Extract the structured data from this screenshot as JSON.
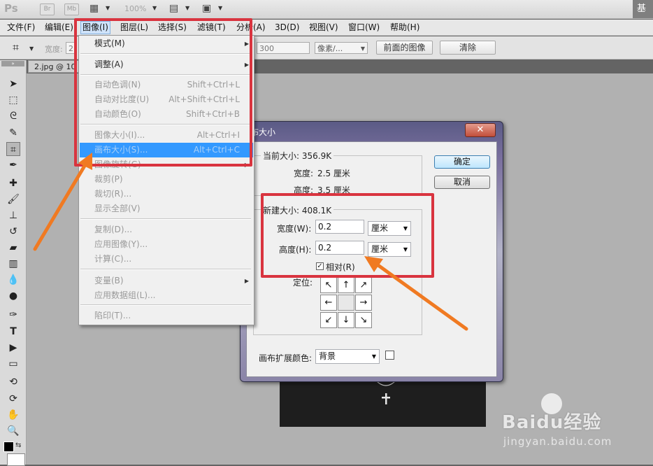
{
  "titlebar": {
    "app_logo": "Ps",
    "bridge_label": "Br",
    "minibridge_label": "Mb",
    "zoom": "100%",
    "workspace_label": "基"
  },
  "menubar": {
    "items": [
      "文件(F)",
      "编辑(E)",
      "图像(I)",
      "图层(L)",
      "选择(S)",
      "滤镜(T)",
      "分析(A)",
      "3D(D)",
      "视图(V)",
      "窗口(W)",
      "帮助(H)"
    ]
  },
  "options_bar": {
    "width_label": "宽度:",
    "width_value": "2",
    "resolution_value": "300",
    "unit_value": "像素/...",
    "front_image_button": "前面的图像",
    "clear_button": "清除"
  },
  "document": {
    "tab_label": "2.jpg @ 10"
  },
  "image_menu": {
    "items": [
      {
        "label": "模式(M)",
        "shortcut": "",
        "submenu": true,
        "disabled": false,
        "highlighted": false
      },
      {
        "label": "调整(A)",
        "shortcut": "",
        "submenu": true,
        "disabled": false,
        "highlighted": false
      },
      {
        "label": "自动色调(N)",
        "shortcut": "Shift+Ctrl+L",
        "submenu": false,
        "disabled": true,
        "highlighted": false
      },
      {
        "label": "自动对比度(U)",
        "shortcut": "Alt+Shift+Ctrl+L",
        "submenu": false,
        "disabled": true,
        "highlighted": false
      },
      {
        "label": "自动颜色(O)",
        "shortcut": "Shift+Ctrl+B",
        "submenu": false,
        "disabled": true,
        "highlighted": false
      },
      {
        "label": "图像大小(I)...",
        "shortcut": "Alt+Ctrl+I",
        "submenu": false,
        "disabled": true,
        "highlighted": false
      },
      {
        "label": "画布大小(S)...",
        "shortcut": "Alt+Ctrl+C",
        "submenu": false,
        "disabled": false,
        "highlighted": true
      },
      {
        "label": "图像旋转(G)",
        "shortcut": "",
        "submenu": true,
        "disabled": true,
        "highlighted": false
      },
      {
        "label": "裁剪(P)",
        "shortcut": "",
        "submenu": false,
        "disabled": true,
        "highlighted": false
      },
      {
        "label": "裁切(R)...",
        "shortcut": "",
        "submenu": false,
        "disabled": true,
        "highlighted": false
      },
      {
        "label": "显示全部(V)",
        "shortcut": "",
        "submenu": false,
        "disabled": true,
        "highlighted": false
      },
      {
        "label": "复制(D)...",
        "shortcut": "",
        "submenu": false,
        "disabled": true,
        "highlighted": false
      },
      {
        "label": "应用图像(Y)...",
        "shortcut": "",
        "submenu": false,
        "disabled": true,
        "highlighted": false
      },
      {
        "label": "计算(C)...",
        "shortcut": "",
        "submenu": false,
        "disabled": true,
        "highlighted": false
      },
      {
        "label": "变量(B)",
        "shortcut": "",
        "submenu": true,
        "disabled": true,
        "highlighted": false
      },
      {
        "label": "应用数据组(L)...",
        "shortcut": "",
        "submenu": false,
        "disabled": true,
        "highlighted": false
      },
      {
        "label": "陷印(T)...",
        "shortcut": "",
        "submenu": false,
        "disabled": true,
        "highlighted": false
      }
    ]
  },
  "dialog": {
    "title": "布大小",
    "close_glyph": "✕",
    "current_size_label": "当前大小: 356.9K",
    "current_width_label": "宽度:",
    "current_width_value": "2.5 厘米",
    "current_height_label": "高度:",
    "current_height_value": "3.5 厘米",
    "new_size_label": "新建大小: 408.1K",
    "width_label": "宽度(W):",
    "width_value": "0.2",
    "width_unit": "厘米",
    "height_label": "高度(H):",
    "height_value": "0.2",
    "height_unit": "厘米",
    "relative_label": "相对(R)",
    "relative_checked": true,
    "anchor_label": "定位:",
    "anchor_arrows": [
      "↖",
      "↑",
      "↗",
      "←",
      "",
      "→",
      "↙",
      "↓",
      "↘"
    ],
    "extension_color_label": "画布扩展颜色:",
    "extension_color_value": "背景",
    "ok_button": "确定",
    "cancel_button": "取消"
  },
  "watermark": {
    "line1": "Baidu经验",
    "line2": "jingyan.baidu.com"
  },
  "colors": {
    "highlight": "#3399ff",
    "annotation_red": "#d9343f",
    "annotation_arrow": "#f07a22"
  }
}
